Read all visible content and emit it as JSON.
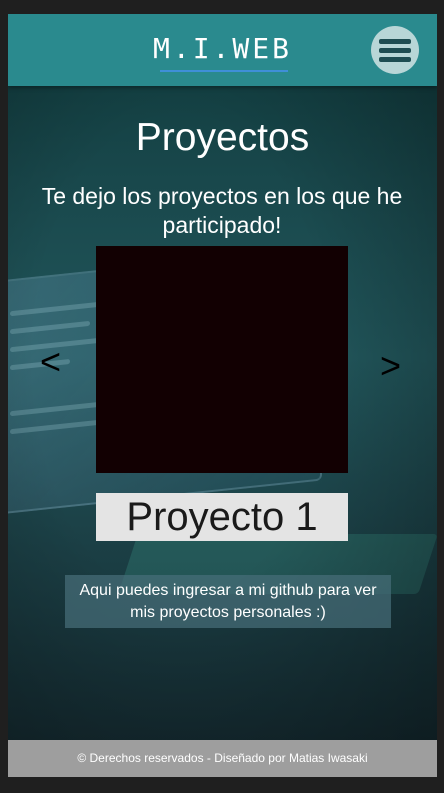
{
  "header": {
    "brand": "M.I.WEB",
    "menu_icon": "hamburger-menu-icon"
  },
  "main": {
    "title": "Proyectos",
    "subtitle": "Te dejo los proyectos en los que he participado!",
    "carousel": {
      "prev_label": "<",
      "next_label": ">",
      "project_name": "Proyecto 1"
    },
    "github_text": "Aqui puedes ingresar a mi github para ver mis proyectos personales :)"
  },
  "footer": {
    "text": "© Derechos reservados - Diseñado por Matias Iwasaki"
  },
  "colors": {
    "header_bg": "#2a8a8e",
    "menu_button_bg": "#b8d6d7",
    "project_image_bg": "#120002",
    "project_name_bg": "#e4e4e4",
    "footer_bg": "#9e9e9e"
  }
}
